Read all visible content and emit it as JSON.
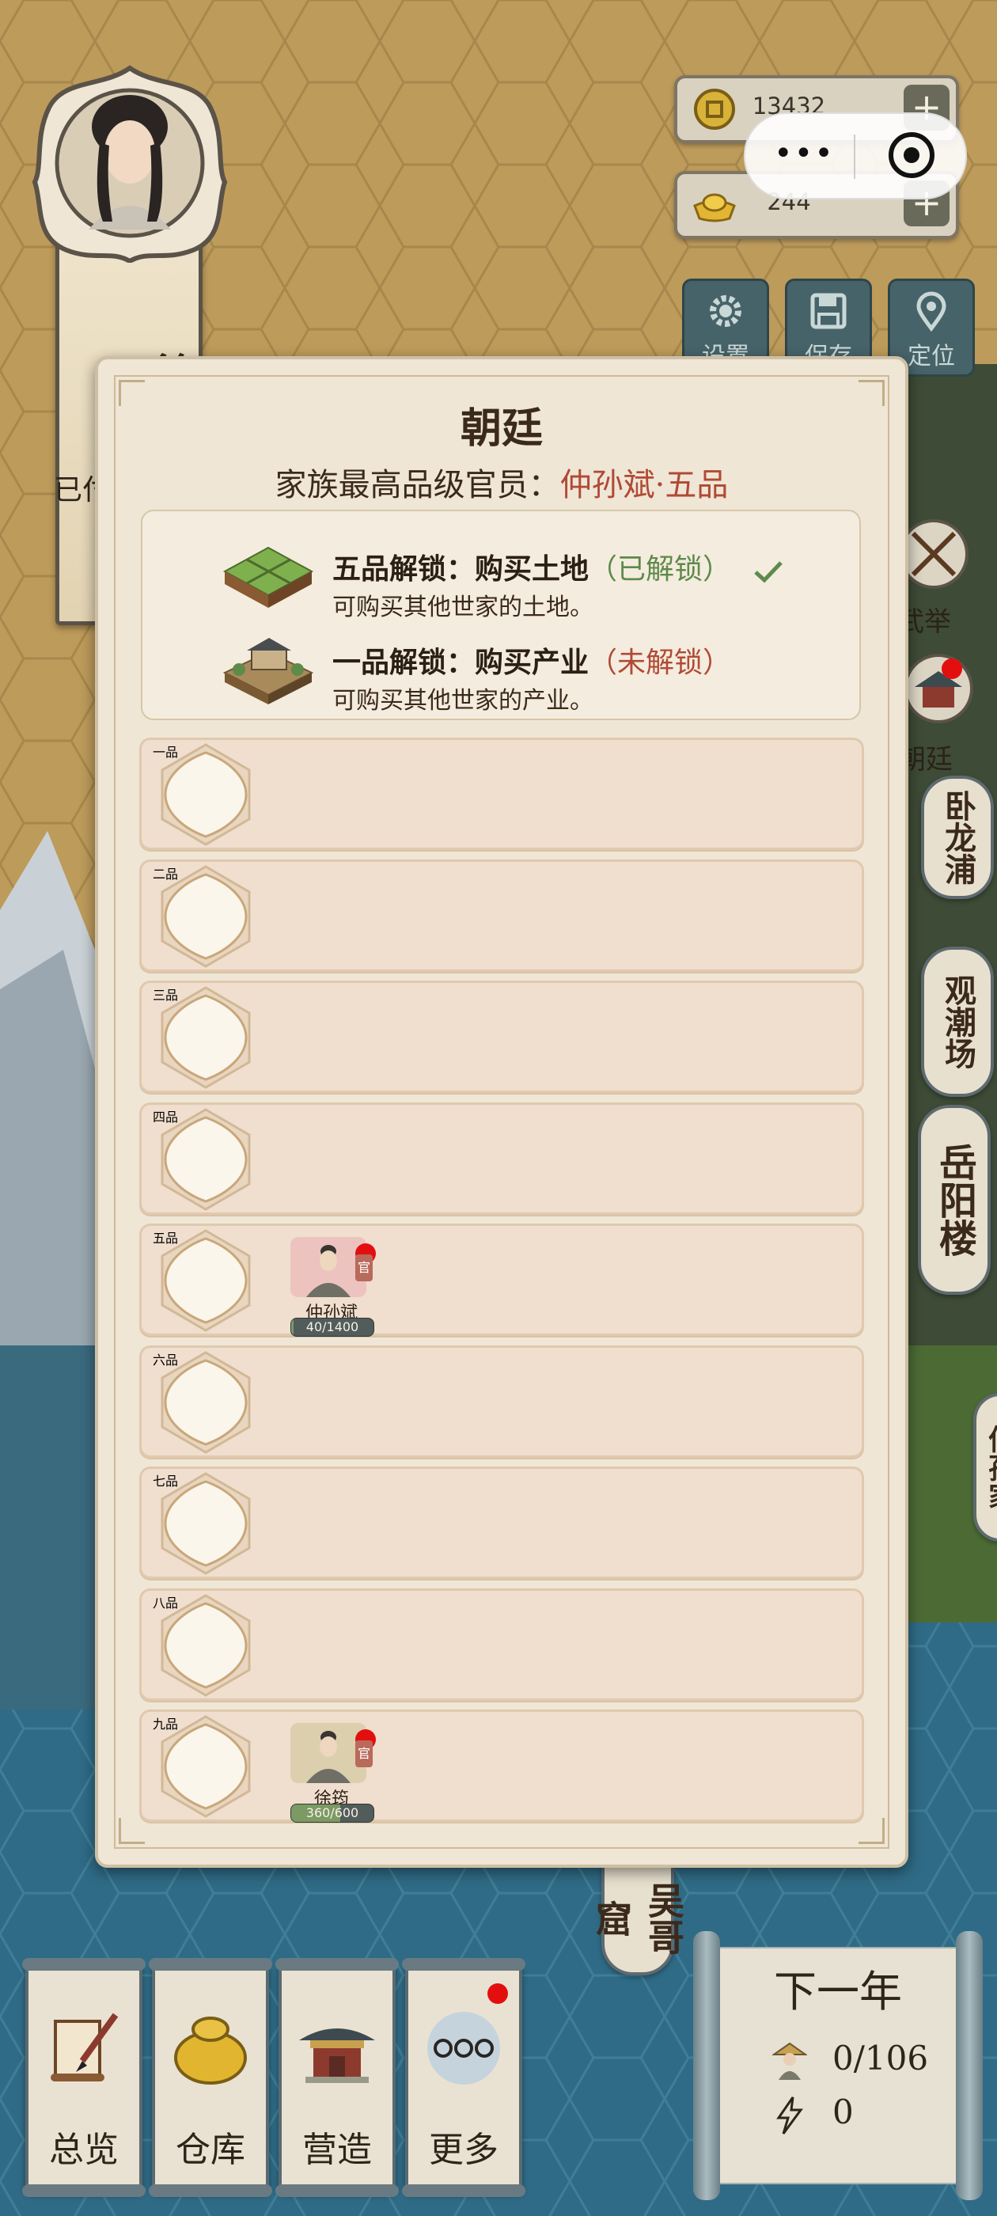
{
  "character": {
    "name": "徐氏",
    "status": "已付"
  },
  "resources": {
    "coins": {
      "icon": "copper-coin-icon",
      "value": "13432",
      "plus": "+"
    },
    "gold": {
      "icon": "gold-ingot-icon",
      "value": "244",
      "plus": "+"
    }
  },
  "capsule": {
    "more": "•••",
    "close": "target-icon"
  },
  "top_buttons": [
    {
      "label": "设置",
      "icon": "gear-icon"
    },
    {
      "label": "保存",
      "icon": "floppy-icon"
    },
    {
      "label": "定位",
      "icon": "map-pin-icon"
    }
  ],
  "side": {
    "exam": "武举",
    "court": "朝廷",
    "scrolls": [
      "卧龙浦",
      "观潮场",
      "岳阳楼",
      "仲孙家",
      "吴哥窟"
    ]
  },
  "modal": {
    "title": "朝廷",
    "subtitle_prefix": "家族最高品级官员：",
    "subtitle_value": "仲孙斌·五品",
    "unlocks": [
      {
        "icon": "farmland-icon",
        "title": "五品解锁：购买土地",
        "state": "（已解锁）",
        "unlocked": true,
        "desc": "可购买其他世家的土地。"
      },
      {
        "icon": "estate-icon",
        "title": "一品解锁：购买产业",
        "state": "（未解锁）",
        "unlocked": false,
        "desc": "可购买其他世家的产业。"
      }
    ],
    "ranks": [
      {
        "label": "一品",
        "officials": []
      },
      {
        "label": "二品",
        "officials": []
      },
      {
        "label": "三品",
        "officials": []
      },
      {
        "label": "四品",
        "officials": []
      },
      {
        "label": "五品",
        "officials": [
          {
            "name": "仲孙斌",
            "tag": "官",
            "progress": "40/1400",
            "progress_fraction": 0.03
          }
        ]
      },
      {
        "label": "六品",
        "officials": []
      },
      {
        "label": "七品",
        "officials": []
      },
      {
        "label": "八品",
        "officials": []
      },
      {
        "label": "九品",
        "officials": [
          {
            "name": "徐筠",
            "tag": "官",
            "progress": "360/600",
            "progress_fraction": 0.6
          }
        ]
      }
    ]
  },
  "bottom_menu": [
    {
      "label": "总览",
      "icon": "scroll-brush-icon"
    },
    {
      "label": "仓库",
      "icon": "money-bag-icon"
    },
    {
      "label": "营造",
      "icon": "pavilion-icon"
    },
    {
      "label": "更多",
      "icon": "more-dots-icon"
    }
  ],
  "next_year": {
    "title": "下一年",
    "population": "0/106",
    "energy": "0"
  }
}
